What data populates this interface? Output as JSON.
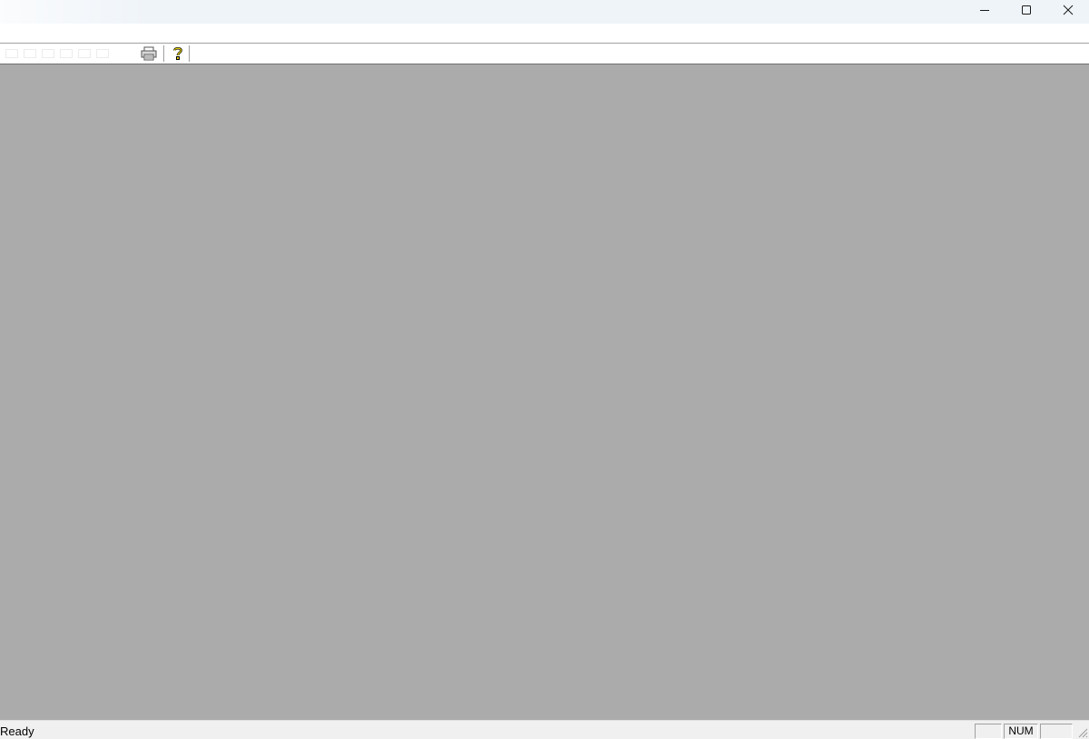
{
  "window": {
    "caption_buttons": {
      "minimize_icon": "minimize-icon",
      "maximize_icon": "maximize-icon",
      "close_icon": "close-icon"
    }
  },
  "toolbar": {
    "buttons": [
      {
        "icon": "print-icon"
      },
      {
        "icon": "help-icon"
      }
    ]
  },
  "statusbar": {
    "message": "Ready",
    "panes": {
      "caps": "",
      "num": "NUM",
      "scroll": ""
    }
  },
  "colors": {
    "client_background": "#ababab",
    "titlebar": "#eff4f9",
    "statusbar": "#f0f0f0"
  }
}
